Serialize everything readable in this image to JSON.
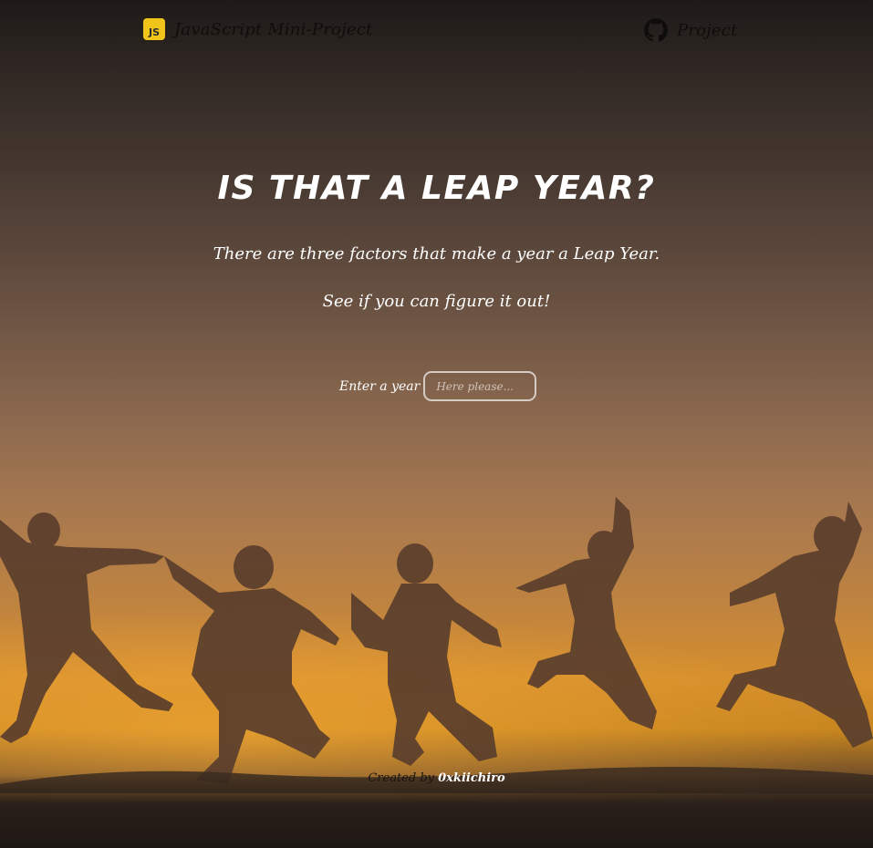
{
  "header": {
    "logo_text": "JS",
    "brand_title": "JavaScript Mini-Project",
    "project_link": "Project",
    "project_icon": "github-icon"
  },
  "hero": {
    "title": "IS THAT A LEAP YEAR?",
    "subtitle_line1": "There are three factors that make a year a Leap Year.",
    "subtitle_line2": "See if you can figure it out!"
  },
  "form": {
    "label": "Enter a year",
    "input_value": "",
    "input_placeholder": "Here please..."
  },
  "footer": {
    "prefix": "Created by",
    "author": "0xkiichiro"
  },
  "colors": {
    "js_logo": "#f0c419",
    "accent_text": "#ffffff"
  }
}
